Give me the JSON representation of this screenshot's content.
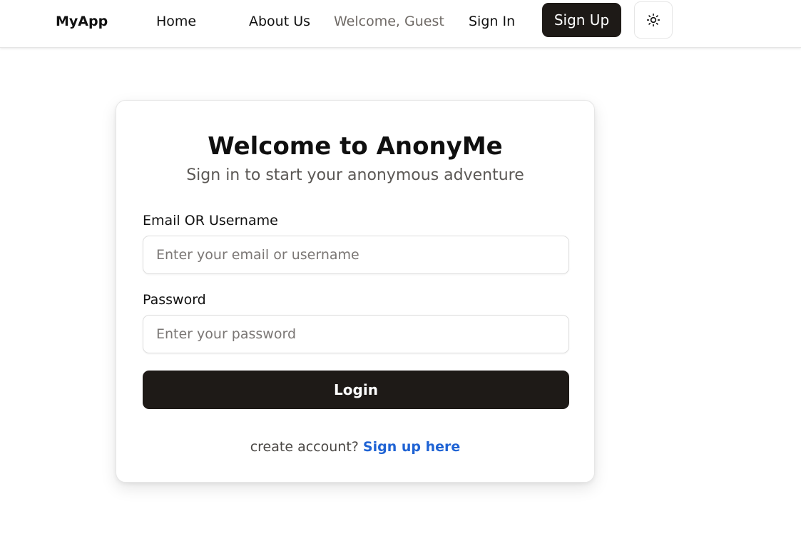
{
  "navbar": {
    "brand": "MyApp",
    "links": {
      "home": "Home",
      "about": "About Us"
    },
    "welcome": "Welcome, Guest",
    "sign_in": "Sign In",
    "sign_up": "Sign Up",
    "theme_toggle_icon": "sun-icon"
  },
  "login_card": {
    "title": "Welcome to AnonyMe",
    "subtitle": "Sign in to start your anonymous adventure",
    "email_field": {
      "label": "Email OR Username",
      "placeholder": "Enter your email or username",
      "value": ""
    },
    "password_field": {
      "label": "Password",
      "placeholder": "Enter your password",
      "value": ""
    },
    "submit_label": "Login",
    "footer": {
      "prompt": "create account?",
      "link": "Sign up here"
    }
  },
  "colors": {
    "primary_button": "#1e1a17",
    "link": "#1f63d4",
    "muted_text": "#6f6a66"
  }
}
